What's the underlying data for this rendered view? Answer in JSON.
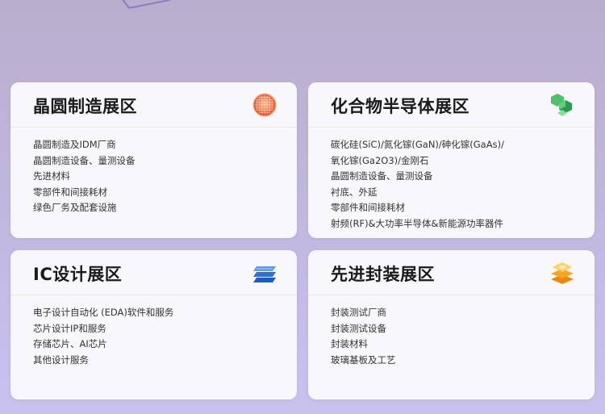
{
  "cards": [
    {
      "title": "晶圆制造展区",
      "icon": "wafer-icon",
      "items": [
        "晶圆制造及IDM厂商",
        "晶圆制造设备、量测设备",
        "先进材料",
        "零部件和间接耗材",
        "绿色厂务及配套设施"
      ]
    },
    {
      "title": "化合物半导体展区",
      "icon": "hexagon-cluster-icon",
      "items": [
        "碳化硅(SiC)/氮化镓(GaN)/砷化镓(GaAs)/",
        "氧化镓(Ga2O3)/金刚石",
        "晶圆制造设备、量测设备",
        "衬底、外延",
        "零部件和间接耗材",
        "射频(RF)&大功率半导体&新能源功率器件"
      ]
    },
    {
      "title": "IC设计展区",
      "icon": "layers-icon",
      "items": [
        "电子设计自动化 (EDA)软件和服务",
        "芯片设计IP和服务",
        "存储芯片、AI芯片",
        "其他设计服务"
      ]
    },
    {
      "title": "先进封装展区",
      "icon": "stacked-package-icon",
      "items": [
        "封装测试厂商",
        "封装测试设备",
        "封装材料",
        "玻璃基板及工艺"
      ]
    }
  ],
  "colors": {
    "wafer": "#f06a2a",
    "hexagon": "#3db05a",
    "layers": "#2f6fd6",
    "package": "#f0a020"
  }
}
